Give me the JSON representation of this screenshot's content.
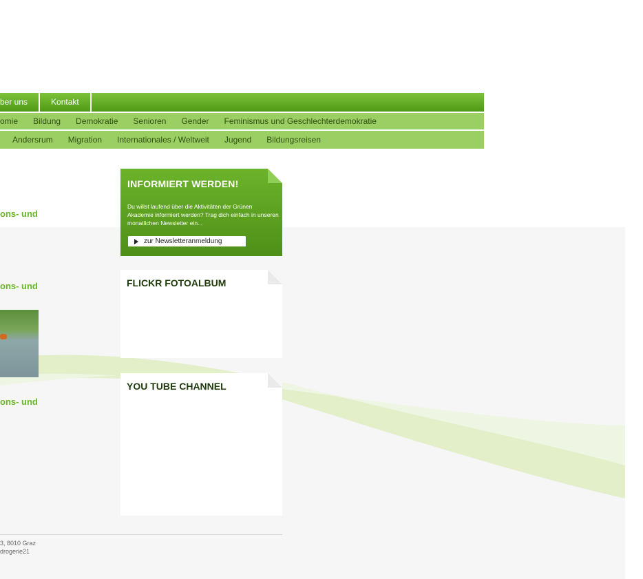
{
  "nav": {
    "top": [
      "ber uns",
      "Kontakt"
    ],
    "mid": [
      "omie",
      "Bildung",
      "Demokratie",
      "Senioren",
      "Gender",
      "Feminismus und Geschlechterdemokratie"
    ],
    "bottom": [
      "Andersrum",
      "Migration",
      "Internationales / Weltweit",
      "Jugend",
      "Bildungsreisen"
    ]
  },
  "content": {
    "teasers": [
      "ons- und",
      "ons- und",
      "ons- und"
    ]
  },
  "sidebar": {
    "newsletter": {
      "title": "INFORMIERT WERDEN!",
      "text": "Du willst laufend über die Aktivitäten der Grünen Akademie informiert werden? Trag dich einfach in unseren monatlichen Newsletter ein...",
      "button": "zur Newsletteranmeldung"
    },
    "flickr_title": "FLICKR FOTOALBUM",
    "youtube_title": "YOU TUBE CHANNEL"
  },
  "footer": {
    "line1": "3, 8010 Graz",
    "line2": "drogerie21"
  },
  "colors": {
    "nav_green": "#5ea821",
    "nav_light": "#9ccf63",
    "accent": "#6db52a",
    "heading_dark": "#1f3a0b"
  }
}
